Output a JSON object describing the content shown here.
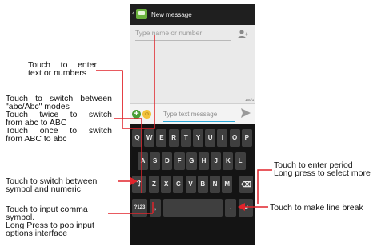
{
  "screen": {
    "title": "New message",
    "recipient_placeholder": "Type name or number",
    "message_placeholder": "Type text message",
    "char_counter": "160/1"
  },
  "keyboard": {
    "row1": [
      "Q",
      "W",
      "E",
      "R",
      "T",
      "Y",
      "U",
      "I",
      "O",
      "P"
    ],
    "row2": [
      "A",
      "S",
      "D",
      "F",
      "G",
      "H",
      "J",
      "K",
      "L"
    ],
    "row3": [
      "Z",
      "X",
      "C",
      "V",
      "B",
      "N",
      "M"
    ],
    "shift_key": "⇧",
    "delete_key": "⌫",
    "symbols_key": "?123",
    "comma_key": ",",
    "space_key": "",
    "period_key": ".",
    "enter_key": "↵"
  },
  "callouts": {
    "enter_text": [
      "Touch to enter",
      "text or numbers"
    ],
    "mode_switch": [
      "Touch to switch between",
      "\"abc/Abc\" modes",
      "Touch twice to switch",
      "from abc to ABC",
      "Touch once to switch",
      "from ABC to abc"
    ],
    "symbol_switch": [
      "Touch to switch between",
      "symbol and numeric"
    ],
    "comma": [
      "Touch to input comma",
      "symbol.",
      "Long Press to pop input",
      "options interface"
    ],
    "period": [
      "Touch to enter period",
      "Long press to select more"
    ],
    "line_break": "Touch to make line break"
  },
  "colors": {
    "callout_line": "#e0242b",
    "accent_blue": "#2ba7d6",
    "app_green": "#6cb33f"
  }
}
